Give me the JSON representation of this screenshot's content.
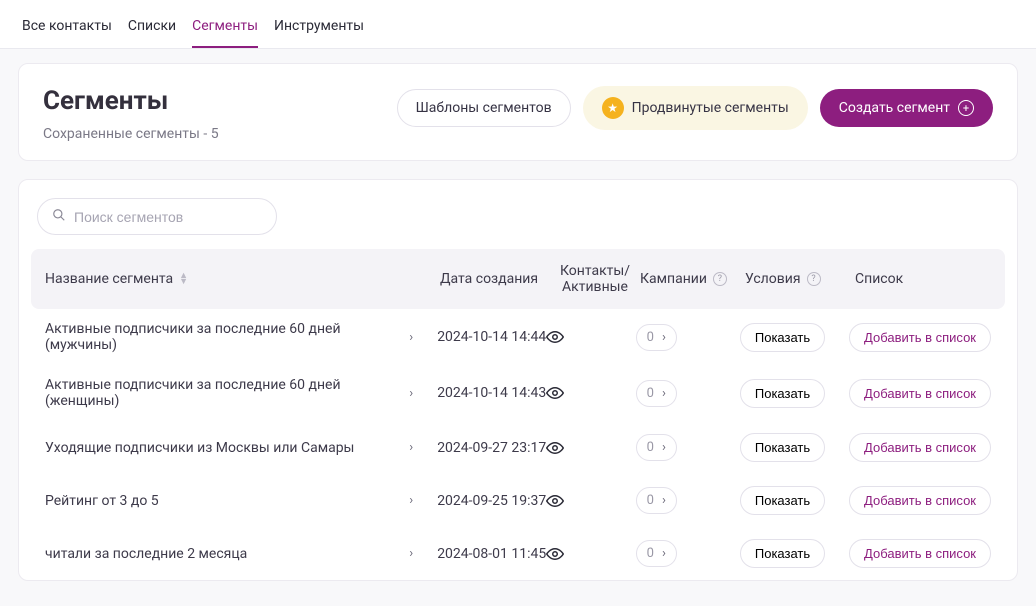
{
  "tabs": {
    "items": [
      {
        "label": "Все контакты",
        "active": false
      },
      {
        "label": "Списки",
        "active": false
      },
      {
        "label": "Сегменты",
        "active": true
      },
      {
        "label": "Инструменты",
        "active": false
      }
    ]
  },
  "header": {
    "title": "Сегменты",
    "subtitle_prefix": "Сохраненные сегменты - ",
    "saved_count": "5",
    "templates_btn": "Шаблоны сегментов",
    "advanced_btn": "Продвинутые сегменты",
    "create_btn": "Создать сегмент"
  },
  "search": {
    "placeholder": "Поиск сегментов"
  },
  "table": {
    "columns": {
      "name": "Название сегмента",
      "date": "Дата создания",
      "contacts": "Контакты/Активные",
      "campaigns": "Кампании",
      "conditions": "Условия",
      "list": "Список"
    },
    "rows": [
      {
        "name": "Активные подписчики за последние 60 дней (мужчины)",
        "date": "2024-10-14 14:44",
        "campaigns": "0",
        "conditions": "Показать",
        "list": "Добавить в список"
      },
      {
        "name": "Активные подписчики за последние 60 дней (женщины)",
        "date": "2024-10-14 14:43",
        "campaigns": "0",
        "conditions": "Показать",
        "list": "Добавить в список"
      },
      {
        "name": "Уходящие подписчики из Москвы или Самары",
        "date": "2024-09-27 23:17",
        "campaigns": "0",
        "conditions": "Показать",
        "list": "Добавить в список"
      },
      {
        "name": "Рейтинг от 3 до 5",
        "date": "2024-09-25 19:37",
        "campaigns": "0",
        "conditions": "Показать",
        "list": "Добавить в список"
      },
      {
        "name": "читали за последние 2 месяца",
        "date": "2024-08-01 11:45",
        "campaigns": "0",
        "conditions": "Показать",
        "list": "Добавить в список"
      }
    ]
  }
}
